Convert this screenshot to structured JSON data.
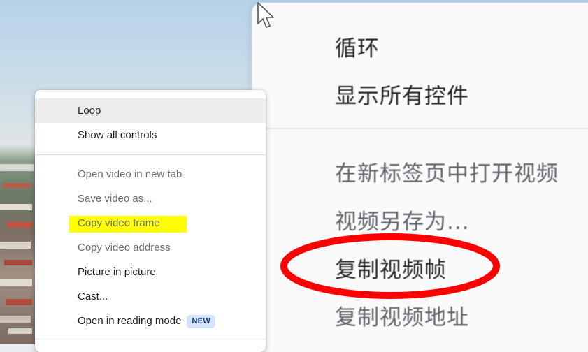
{
  "context_menu": {
    "items": [
      {
        "label": "Loop"
      },
      {
        "label": "Show all controls"
      },
      {
        "label": "Open video in new tab"
      },
      {
        "label": "Save video as..."
      },
      {
        "label": "Copy video frame"
      },
      {
        "label": "Copy video address"
      },
      {
        "label": "Picture in picture"
      },
      {
        "label": "Cast..."
      },
      {
        "label": "Open in reading mode",
        "badge": "NEW"
      }
    ]
  },
  "zoomed_menu": {
    "items": [
      {
        "label": "循环"
      },
      {
        "label": "显示所有控件"
      },
      {
        "label": "在新标签页中打开视频"
      },
      {
        "label": "视频另存为..."
      },
      {
        "label": "复制视频帧"
      },
      {
        "label": "复制视频地址"
      }
    ]
  },
  "colors": {
    "highlight": "#ffff00",
    "annotation_circle": "#ff0000",
    "badge_bg": "#d3e3fd"
  }
}
